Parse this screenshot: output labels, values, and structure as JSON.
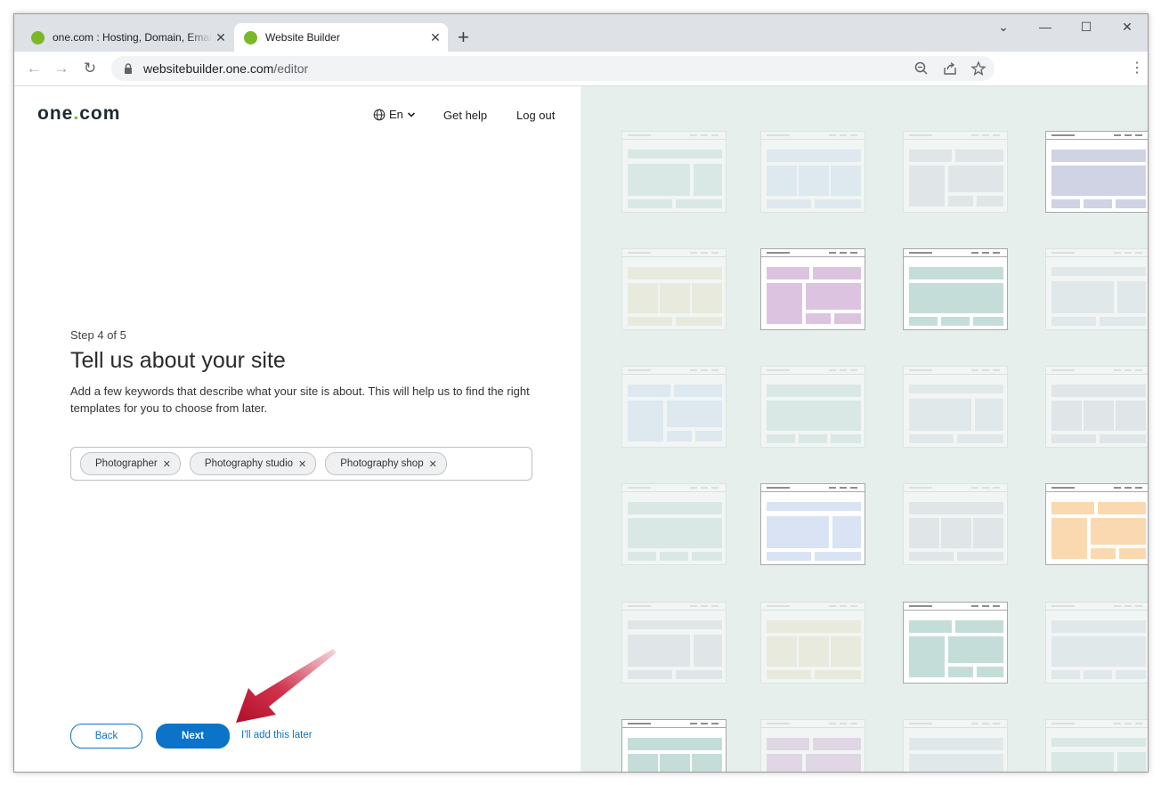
{
  "browser": {
    "tabs": [
      {
        "title": "one.com : Hosting, Domain, Email",
        "close": "✕"
      },
      {
        "title": "Website Builder",
        "close": "✕"
      }
    ],
    "new_tab": "+",
    "url_host": "websitebuilder.one.com",
    "url_path": "/editor",
    "window_controls": [
      "⌄",
      "—",
      "☐",
      "✕"
    ]
  },
  "header": {
    "logo_main": "one",
    "logo_dot": ".",
    "logo_tail": "com",
    "language": "En",
    "get_help": "Get help",
    "log_out": "Log out"
  },
  "wizard": {
    "step": "Step 4 of 5",
    "title": "Tell us about your site",
    "description": "Add a few keywords that describe what your site is about. This will help us to find the right templates for you to choose from later.",
    "keywords": [
      "Photographer",
      "Photography studio",
      "Photography shop"
    ],
    "back": "Back",
    "next": "Next",
    "later": "I'll add this later"
  },
  "colors": {
    "brand_green": "#7ab828",
    "primary_blue": "#0b74c8",
    "preview_bg": "#e6efec",
    "annotation_arrow": "#c8102e"
  }
}
